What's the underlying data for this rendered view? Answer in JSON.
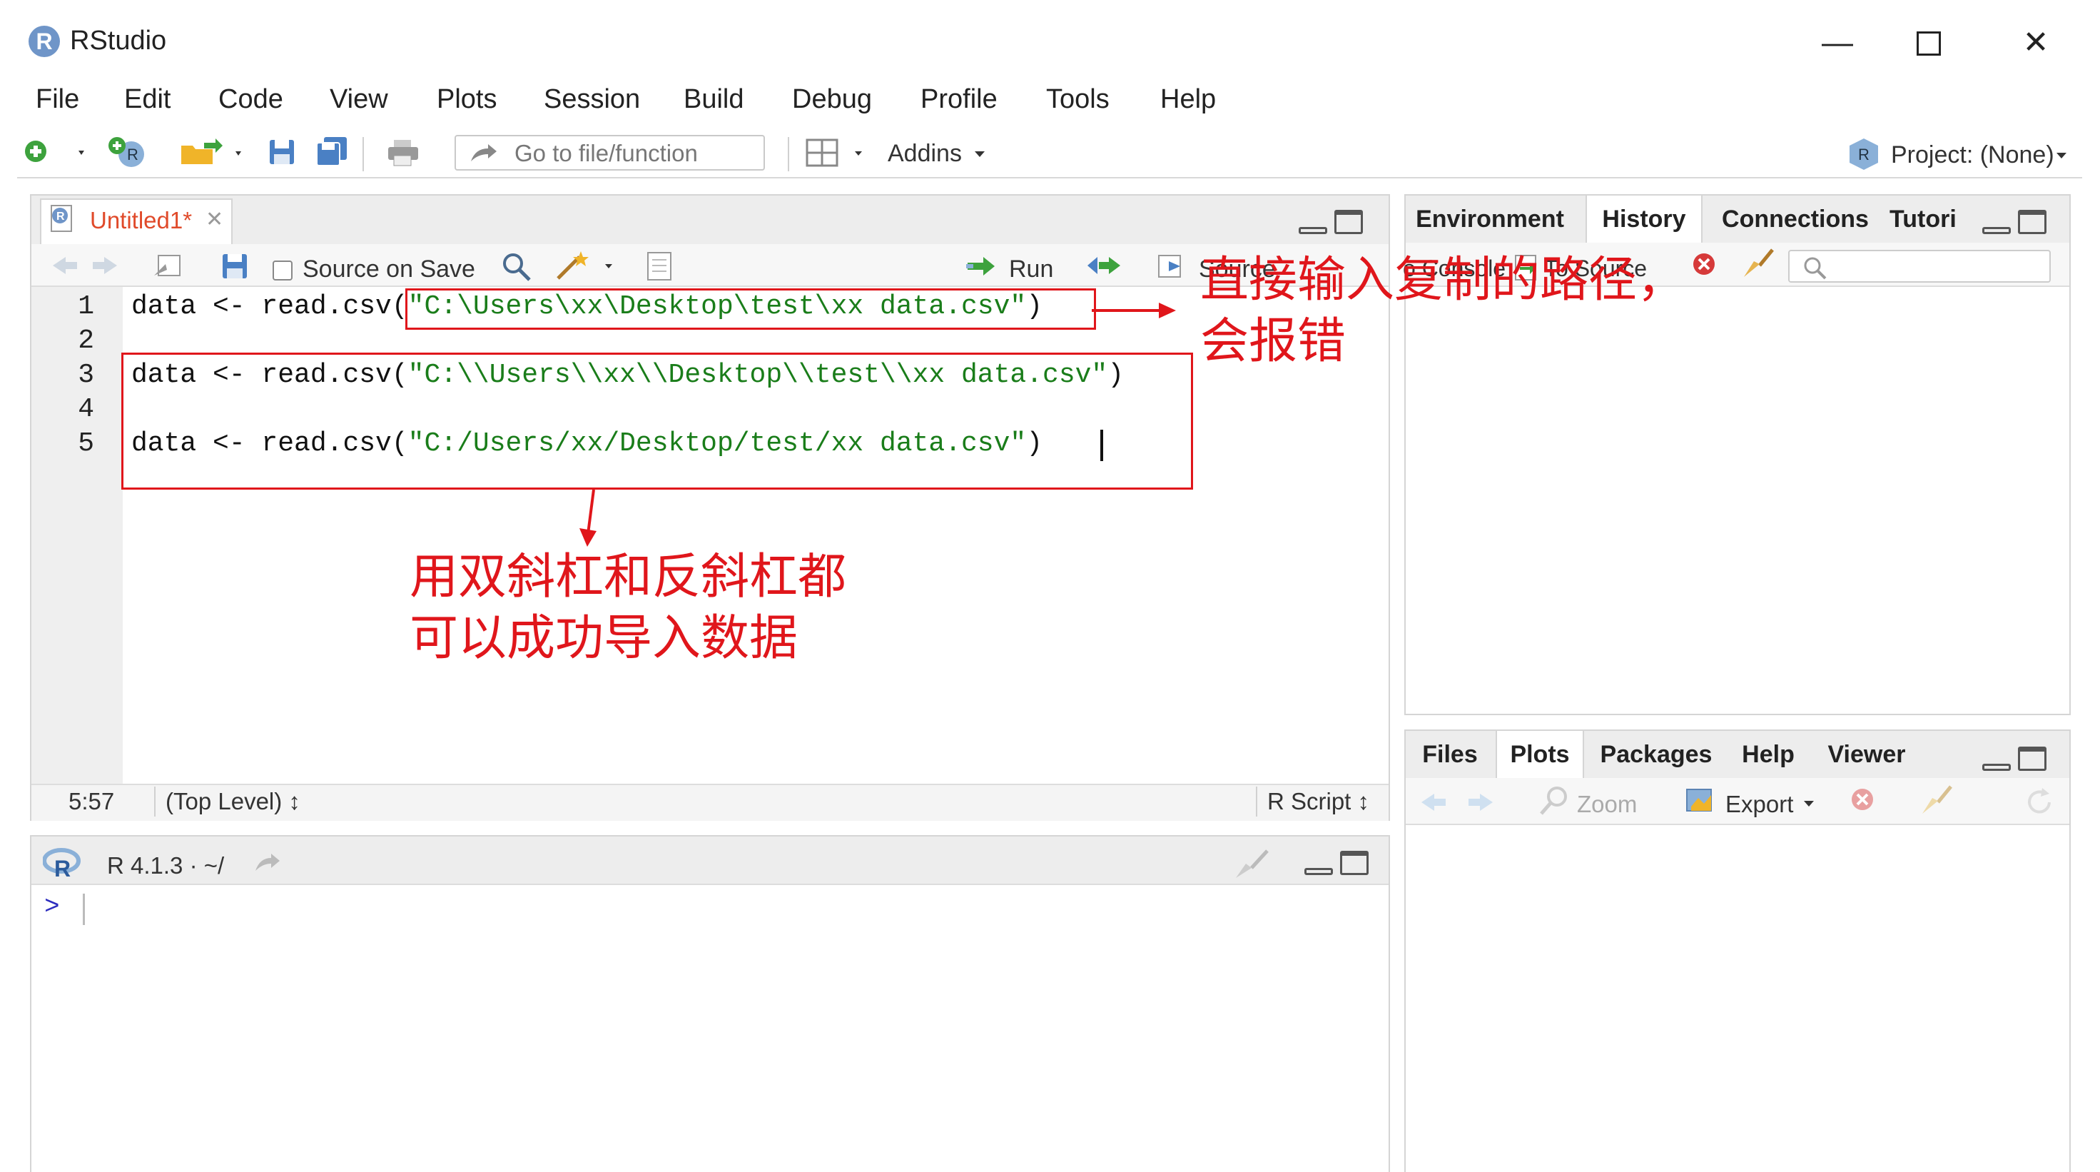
{
  "app": {
    "title": "RStudio"
  },
  "menu": [
    "File",
    "Edit",
    "Code",
    "View",
    "Plots",
    "Session",
    "Build",
    "Debug",
    "Profile",
    "Tools",
    "Help"
  ],
  "toolbar": {
    "goto_placeholder": "Go to file/function",
    "addins": "Addins",
    "project": "Project: (None)"
  },
  "editor": {
    "tab": "Untitled1*",
    "source_on_save": "Source on Save",
    "run": "Run",
    "source": "Source",
    "lines": [
      {
        "num": "1",
        "pre": "data <- read.csv(",
        "str": "\"C:\\Users\\xx\\Desktop\\test\\xx data.csv\"",
        "post": ")"
      },
      {
        "num": "2",
        "pre": "",
        "str": "",
        "post": ""
      },
      {
        "num": "3",
        "pre": "data <- read.csv(",
        "str": "\"C:\\\\Users\\\\xx\\\\Desktop\\\\test\\\\xx data.csv\"",
        "post": ")"
      },
      {
        "num": "4",
        "pre": "",
        "str": "",
        "post": ""
      },
      {
        "num": "5",
        "pre": "data <- read.csv(",
        "str": "\"C:/Users/xx/Desktop/test/xx data.csv\"",
        "post": ")"
      }
    ],
    "status_position": "5:57",
    "status_scope": "(Top Level) ↕",
    "status_type": "R Script ↕"
  },
  "console": {
    "version": "R 4.1.3 · ~/",
    "prompt": ">"
  },
  "env_pane": {
    "tabs": [
      "Environment",
      "History",
      "Connections",
      "Tutori"
    ],
    "active": "History",
    "to_console": "o Console",
    "to_source": "To Source"
  },
  "files_pane": {
    "tabs": [
      "Files",
      "Plots",
      "Packages",
      "Help",
      "Viewer"
    ],
    "active": "Plots",
    "zoom": "Zoom",
    "export": "Export"
  },
  "annotations": {
    "top": "直接输入复制的路径，\n会报错",
    "bottom": "用双斜杠和反斜杠都\n可以成功导入数据"
  },
  "colors": {
    "annotation": "#e0161b",
    "string": "#1a7d1a",
    "accent": "#6f95c8"
  }
}
